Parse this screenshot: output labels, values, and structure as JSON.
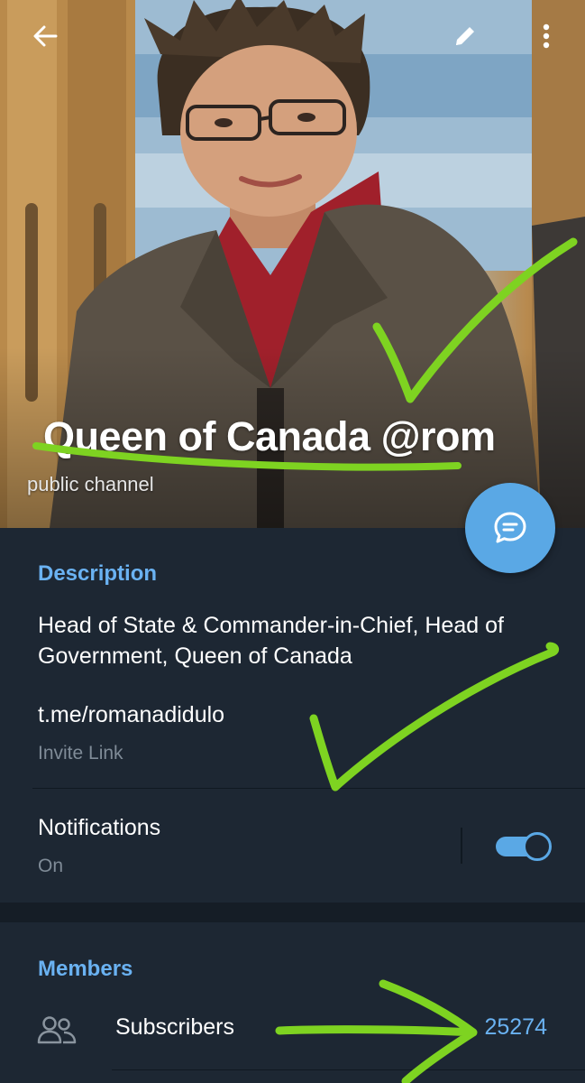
{
  "channel": {
    "title": "Queen of Canada @rom",
    "subtitle": "public channel"
  },
  "description": {
    "heading": "Description",
    "text": "Head of State & Commander-in-Chief, Head of Government,  Queen of Canada"
  },
  "invite": {
    "link": "t.me/romanadidulo",
    "label": "Invite Link"
  },
  "notifications": {
    "label": "Notifications",
    "status": "On",
    "enabled": true
  },
  "members": {
    "heading": "Members",
    "subscribers_label": "Subscribers",
    "subscribers_count": "25274"
  },
  "icons": {
    "back": "back-arrow-icon",
    "edit": "pencil-icon",
    "more": "more-vertical-icon",
    "chat": "chat-bubble-icon",
    "subscribers": "people-icon"
  },
  "colors": {
    "accent": "#6ab2f2",
    "fab": "#5aa8e5",
    "background": "#1d2733",
    "annotation": "#7ed321"
  }
}
